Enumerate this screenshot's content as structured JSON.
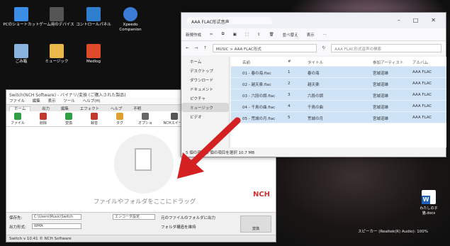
{
  "desktop": {
    "icons": [
      {
        "label": "PCのショートカット"
      },
      {
        "label": "ゲーム用のデバイス"
      },
      {
        "label": "コントロールパネル"
      },
      {
        "label": "Xpeedo Companion"
      },
      {
        "label": "ごみ箱"
      },
      {
        "label": "ミュージック"
      },
      {
        "label": "Medlog"
      }
    ],
    "word_icon_label": "わたしの子猫.docx",
    "speaker_text": "スピーカー (Realtek(R) Audio): 100%"
  },
  "switch": {
    "title": "Switch(NCH Software) - バイナリ/変換 (ご購入された製品)",
    "menu": [
      "ファイル",
      "編集",
      "表示",
      "ツール",
      "ヘルプ(H)"
    ],
    "tabs": [
      "ホーム",
      "出力",
      "編集",
      "エフェクト",
      "ヘルプ",
      "不明"
    ],
    "active_tab": "ホーム",
    "ribbon": [
      {
        "label": "ファイル",
        "icon": "add-file-icon",
        "color": "#2ea043"
      },
      {
        "label": "削除",
        "icon": "delete-icon",
        "color": "#c0392b"
      },
      {
        "label": "変換",
        "icon": "convert-icon",
        "color": "#2ea043"
      },
      {
        "label": "録音",
        "icon": "record-icon",
        "color": "#c0392b"
      },
      {
        "label": "タグ",
        "icon": "tag-icon",
        "color": "#e0a030"
      },
      {
        "label": "オプション",
        "icon": "options-icon",
        "color": "#666"
      },
      {
        "label": "NCHスイート",
        "icon": "nch-suite-icon",
        "color": "#555"
      }
    ],
    "drop_text": "ファイルやフォルダをここにドラッグ",
    "nch_logo": "NCH",
    "bottom": {
      "save_label": "保存先:",
      "save_value": "C:\\Users\\Music\\Switch",
      "format_label": "出力形式:",
      "format_value": "WMA",
      "options_button": "エンコーダ設定",
      "convert_button": "変換",
      "checkbox1": "元のファイルのフォルダに出力",
      "checkbox2": "フォルダ構造を維持"
    },
    "status": "Switch v 10.41 © NCH Software"
  },
  "explorer": {
    "tab_title": "AAA FLAC形式音声",
    "commands": [
      "新規作成",
      "切り取り",
      "コピー",
      "貼り付け",
      "名前の変更",
      "共有",
      "削除",
      "並べ替え",
      "表示"
    ],
    "address": "MUSIC > AAA FLAC形式",
    "search_placeholder": "AAA FLAC形式音声の検索",
    "nav": [
      "ホーム",
      "デスクトップ",
      "ダウンロード",
      "ドキュメント",
      "ピクチャ",
      "ミュージック",
      "ビデオ"
    ],
    "selected_nav": "ミュージック",
    "columns": [
      "名前",
      "#",
      "タイトル",
      "参加アーティスト",
      "アルバム"
    ],
    "rows": [
      [
        "01 - 春の海.flac",
        "1",
        "春の海",
        "宮城道雄",
        "AAA FLAC"
      ],
      [
        "02 - 越天楽.flac",
        "2",
        "越天楽",
        "宮城道雄",
        "AAA FLAC"
      ],
      [
        "03 - 六段の調.flac",
        "3",
        "六段の調",
        "宮城道雄",
        "AAA FLAC"
      ],
      [
        "04 - 千鳥の曲.flac",
        "4",
        "千鳥の曲",
        "宮城道雄",
        "AAA FLAC"
      ],
      [
        "05 - 荒城の月.flac",
        "5",
        "荒城の月",
        "宮城道雄",
        "AAA FLAC"
      ]
    ],
    "status": "5 個の項目 5 個の項目を選択 10.7 MB"
  },
  "colors": {
    "accent": "#d42020",
    "selection": "#cfe3f7"
  }
}
